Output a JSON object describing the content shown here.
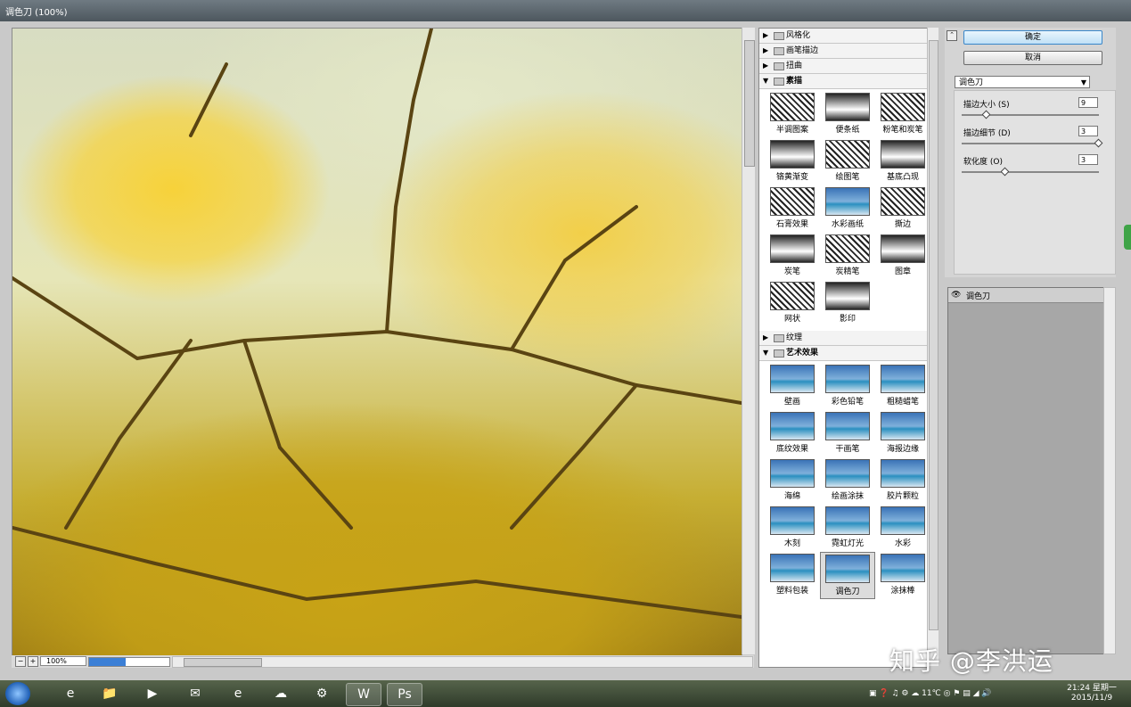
{
  "window": {
    "title": "调色刀 (100%)"
  },
  "preview": {
    "zoom": "100%",
    "progress": 0.45
  },
  "gallery": {
    "folders": [
      {
        "label": "风格化",
        "open": false
      },
      {
        "label": "画笔描边",
        "open": false
      },
      {
        "label": "扭曲",
        "open": false
      },
      {
        "label": "素描",
        "open": true
      },
      {
        "label": "纹理",
        "open": false
      },
      {
        "label": "艺术效果",
        "open": true
      }
    ],
    "sketch_items": [
      "半调图案",
      "便条纸",
      "粉笔和炭笔",
      "铬黄渐变",
      "绘图笔",
      "基底凸现",
      "石膏效果",
      "水彩画纸",
      "撕边",
      "炭笔",
      "炭精笔",
      "图章",
      "网状",
      "影印"
    ],
    "art_items": [
      "壁画",
      "彩色铅笔",
      "粗糙蜡笔",
      "底纹效果",
      "干画笔",
      "海报边缘",
      "海绵",
      "绘画涂抹",
      "胶片颗粒",
      "木刻",
      "霓虹灯光",
      "水彩",
      "塑料包装",
      "调色刀",
      "涂抹棒"
    ],
    "selected": "调色刀"
  },
  "controls": {
    "ok_label": "确定",
    "cancel_label": "取消",
    "filter_select": "调色刀",
    "params": [
      {
        "label": "描边大小 (S)",
        "value": "9",
        "level": 0.16
      },
      {
        "label": "描边细节 (D)",
        "value": "3",
        "level": 1.0
      },
      {
        "label": "软化度 (O)",
        "value": "3",
        "level": 0.3
      }
    ]
  },
  "layers": {
    "items": [
      {
        "name": "调色刀"
      }
    ]
  },
  "taskbar": {
    "apps": [
      "e",
      "📁",
      "▶",
      "✉",
      "e",
      "☁",
      "⚙",
      "W",
      "Ps"
    ],
    "tray_temp": "11℃",
    "time": "21:24 星期一",
    "date": "2015/11/9"
  },
  "watermark": "知乎 @李洪运"
}
